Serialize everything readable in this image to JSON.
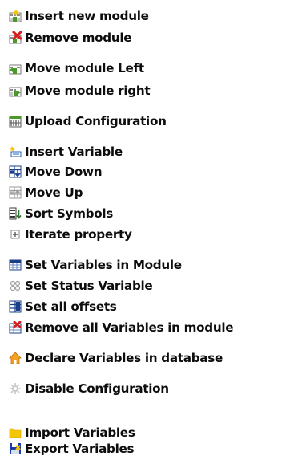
{
  "menu": {
    "items": [
      {
        "label": "Insert new module",
        "icon": "insert-module-icon"
      },
      {
        "label": "Remove module",
        "icon": "remove-module-icon"
      },
      {
        "label": "Move module Left",
        "icon": "move-module-left-icon"
      },
      {
        "label": "Move module right",
        "icon": "move-module-right-icon"
      },
      {
        "label": "Upload Configuration",
        "icon": "upload-configuration-icon"
      },
      {
        "label": "Insert Variable",
        "icon": "insert-variable-icon"
      },
      {
        "label": "Move Down",
        "icon": "move-down-icon"
      },
      {
        "label": "Move Up",
        "icon": "move-up-icon"
      },
      {
        "label": "Sort Symbols",
        "icon": "sort-symbols-icon"
      },
      {
        "label": "Iterate property",
        "icon": "iterate-property-icon"
      },
      {
        "label": "Set Variables in Module",
        "icon": "set-variables-icon"
      },
      {
        "label": "Set Status Variable",
        "icon": "set-status-variable-icon"
      },
      {
        "label": "Set all offsets",
        "icon": "set-offsets-icon"
      },
      {
        "label": "Remove all Variables in module",
        "icon": "remove-variables-icon"
      },
      {
        "label": "Declare Variables in database",
        "icon": "database-icon"
      },
      {
        "label": "Disable Configuration",
        "icon": "disable-configuration-icon"
      },
      {
        "label": "Import Variables",
        "icon": "import-folder-icon"
      },
      {
        "label": "Export Variables",
        "icon": "export-disk-icon"
      }
    ]
  },
  "colors": {
    "text": "#0d0d0d",
    "background": "#ffffff",
    "module_green": "#4a9a2a",
    "remove_red": "#d42020",
    "folder_yellow": "#f7c500",
    "disk_blue": "#1a3fa8",
    "house_orange": "#f4a020"
  }
}
